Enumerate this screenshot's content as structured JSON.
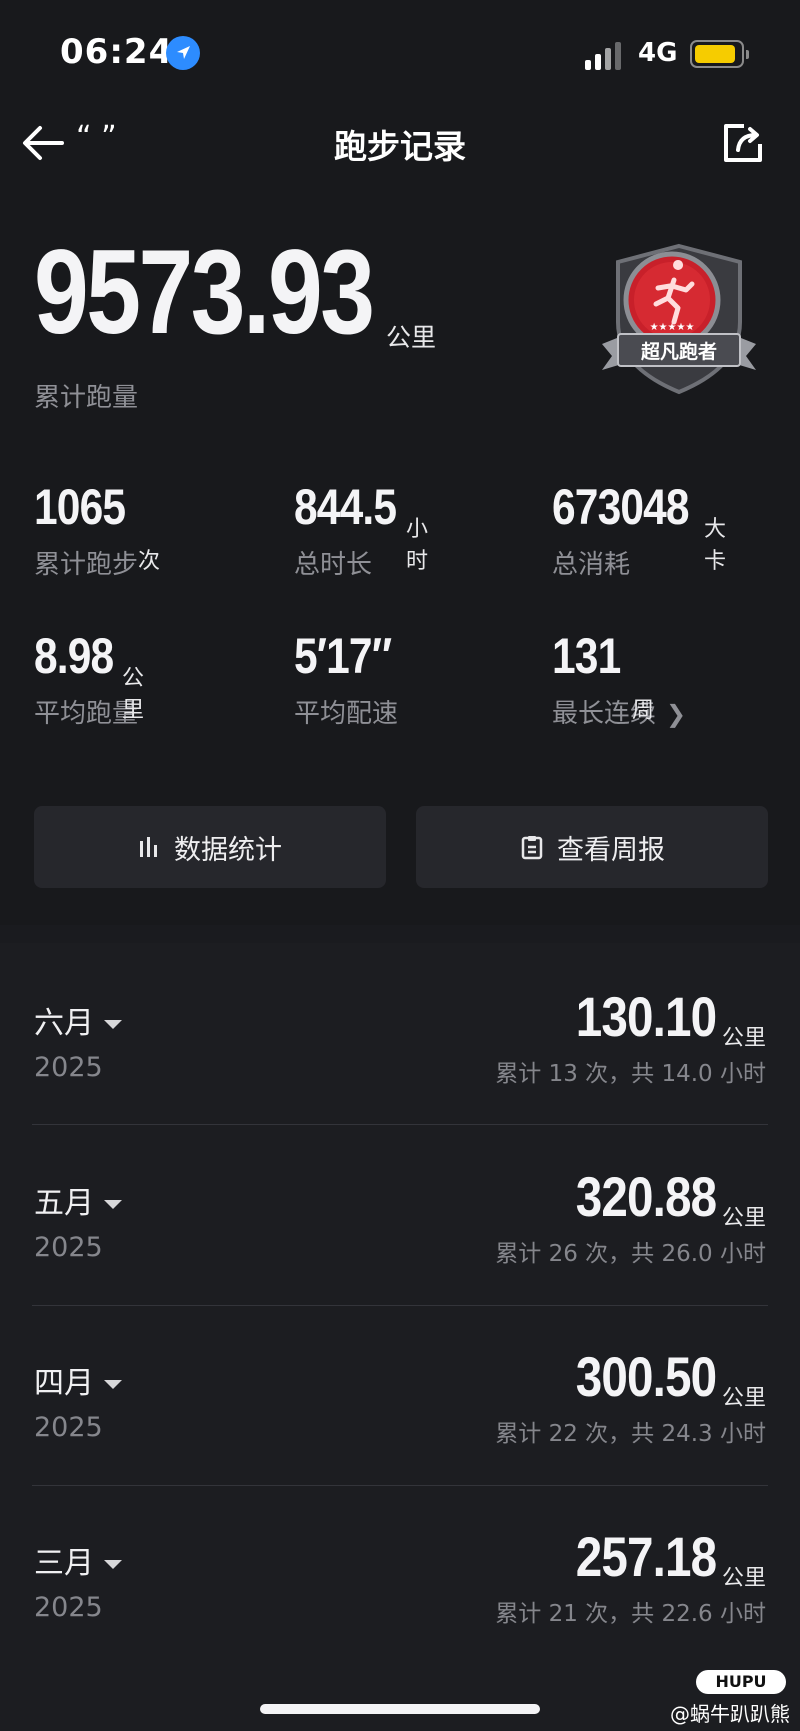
{
  "status_bar": {
    "time": "06:24",
    "network": "4G"
  },
  "nav": {
    "back_quote": "“ ”",
    "title": "跑步记录"
  },
  "hero": {
    "total_distance": "9573.93",
    "total_unit": "公里",
    "total_label": "累计跑量",
    "badge_label": "超凡跑者"
  },
  "stats": [
    {
      "value": "1065",
      "unit": "次",
      "label": "累计跑步"
    },
    {
      "value": "844.5",
      "unit": "小时",
      "label": "总时长"
    },
    {
      "value": "673048",
      "unit": "大卡",
      "label": "总消耗"
    },
    {
      "value": "8.98",
      "unit": "公里",
      "label": "平均跑量"
    },
    {
      "value": "5′17″",
      "unit": "",
      "label": "平均配速"
    },
    {
      "value": "131",
      "unit": "周",
      "label": "最长连续"
    }
  ],
  "buttons": {
    "data_stats": "数据统计",
    "weekly_report": "查看周报"
  },
  "months": [
    {
      "name": "六月",
      "year": "2025",
      "distance": "130.10",
      "unit": "公里",
      "summary": "累计 13 次，共 14.0 小时"
    },
    {
      "name": "五月",
      "year": "2025",
      "distance": "320.88",
      "unit": "公里",
      "summary": "累计 26 次，共 26.0 小时"
    },
    {
      "name": "四月",
      "year": "2025",
      "distance": "300.50",
      "unit": "公里",
      "summary": "累计 22 次，共 24.3 小时"
    },
    {
      "name": "三月",
      "year": "2025",
      "distance": "257.18",
      "unit": "公里",
      "summary": "累计 21 次，共 22.6 小时"
    }
  ],
  "watermark": {
    "logo": "HUPU",
    "handle": "@蜗牛趴趴熊"
  },
  "colors": {
    "background": "#18191c",
    "card": "#26272c",
    "badge_red": "#c8202a",
    "location": "#2d8cff",
    "battery": "#f6cc00"
  }
}
